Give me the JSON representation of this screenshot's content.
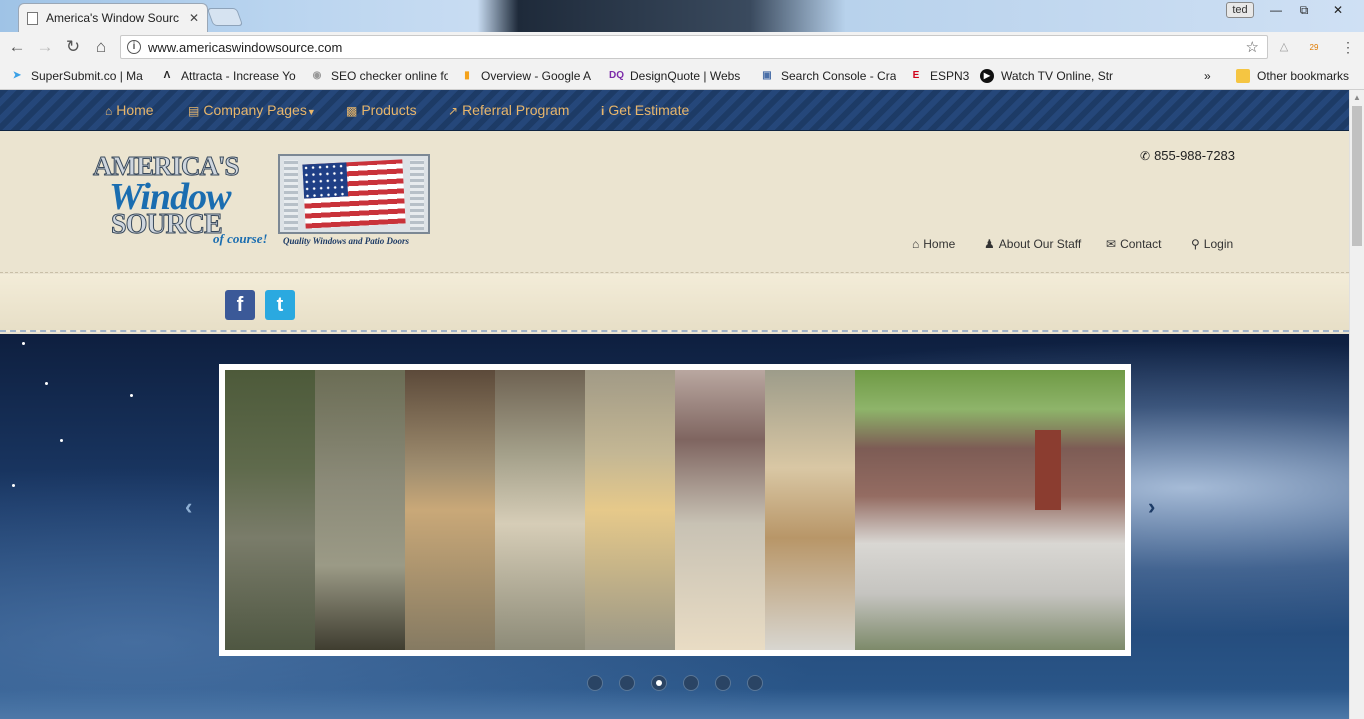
{
  "browser": {
    "tab_title": "America's Window Sourc",
    "tab_close": "✕",
    "profile_label": "ted",
    "url": "www.americaswindowsource.com",
    "extension_badge": "29",
    "bookmarks": [
      {
        "label": "SuperSubmit.co | Ma",
        "icon": "supersubmit-icon",
        "color": "#3aa0e6"
      },
      {
        "label": "Attracta - Increase Yo",
        "icon": "attracta-icon",
        "color": "#222222"
      },
      {
        "label": "SEO checker online fo",
        "icon": "seo-checker-icon",
        "color": "#999999"
      },
      {
        "label": "Overview - Google A",
        "icon": "google-analytics-icon",
        "color": "#f4a21b"
      },
      {
        "label": "DesignQuote | Webs",
        "icon": "designquote-icon",
        "color": "#7b2aa8"
      },
      {
        "label": "Search Console - Cra",
        "icon": "search-console-icon",
        "color": "#4a6fa8"
      },
      {
        "label": "ESPN3",
        "icon": "espn-icon",
        "color": "#d0021b"
      },
      {
        "label": "Watch TV Online, Str",
        "icon": "play-icon",
        "color": "#111111"
      }
    ],
    "more_bookmarks": "»",
    "other_bookmarks": "Other bookmarks"
  },
  "site": {
    "main_nav": [
      {
        "label": "Home",
        "icon": "home-icon"
      },
      {
        "label": "Company Pages",
        "icon": "document-icon",
        "dropdown": true
      },
      {
        "label": "Products",
        "icon": "book-icon"
      },
      {
        "label": "Referral Program",
        "icon": "share-icon"
      },
      {
        "label": "Get Estimate",
        "icon": "info-icon"
      }
    ],
    "logo": {
      "line1": "AMERICA'S",
      "line2": "Window",
      "line3": "SOURCE",
      "tagline": "of course!",
      "flag_caption": "Quality Windows and Patio Doors"
    },
    "phone": "855-988-7283",
    "util_nav": [
      {
        "label": "Home",
        "icon": "home-icon"
      },
      {
        "label": "About Our Staff",
        "icon": "user-icon"
      },
      {
        "label": "Contact",
        "icon": "envelope-icon"
      },
      {
        "label": "Login",
        "icon": "key-icon"
      }
    ],
    "social": [
      {
        "label": "f",
        "icon": "facebook-icon",
        "color": "#3b5998"
      },
      {
        "label": "t",
        "icon": "twitter-icon",
        "color": "#2aa9e0"
      }
    ],
    "slider": {
      "prev_arrow": "‹",
      "next_arrow": "›",
      "slide_count": 6,
      "active_index": 2
    }
  }
}
